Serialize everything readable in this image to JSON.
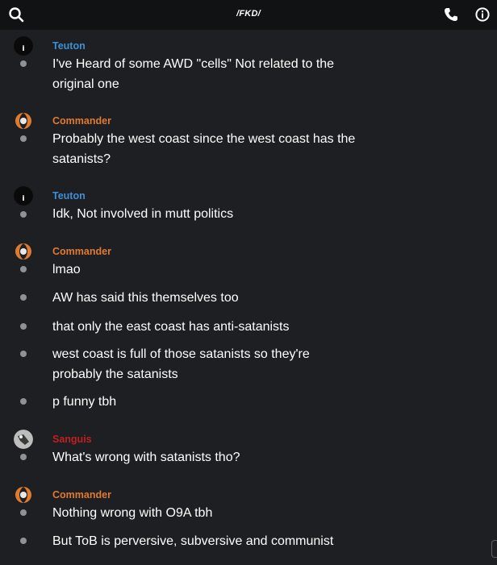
{
  "header": {
    "title": "/FKD/",
    "icons": [
      "search-icon",
      "phone-icon",
      "info-icon"
    ]
  },
  "colors": {
    "background": "#1e1f22",
    "topbar": "#111214",
    "teuton": "#3d8fd6",
    "commander": "#e07a2f",
    "sanguis": "#c0201f",
    "bullet": "#8e9297"
  },
  "messages": [
    {
      "author": "Teuton",
      "lines": [
        "I've Heard of some AWD \"cells\" Not related to the original one"
      ]
    },
    {
      "author": "Commander",
      "lines": [
        "Probably the west coast since the west coast has the satanists?"
      ]
    },
    {
      "author": "Teuton",
      "lines": [
        "Idk, Not involved in mutt politics"
      ]
    },
    {
      "author": "Commander",
      "lines": [
        "lmao",
        "AW has said this themselves too",
        "that only the east coast has anti-satanists",
        "west coast is full of those satanists so they're probably the satanists",
        "p funny tbh"
      ]
    },
    {
      "author": "Sanguis",
      "lines": [
        "What's wrong with satanists tho?"
      ]
    },
    {
      "author": "Commander",
      "lines": [
        "Nothing wrong with O9A tbh",
        "But ToB is perversive, subversive and communist"
      ]
    }
  ]
}
